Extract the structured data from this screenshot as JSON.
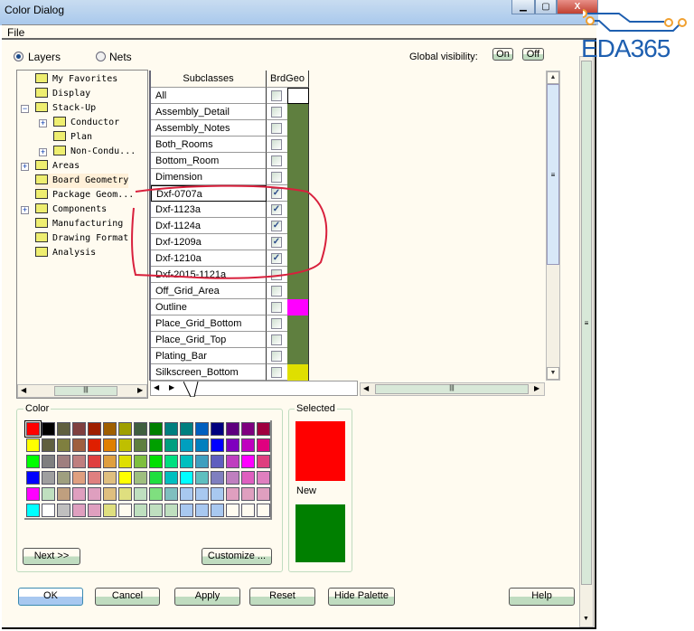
{
  "window": {
    "title": "Color Dialog",
    "controls": [
      "minimize",
      "maximize",
      "close"
    ]
  },
  "menu": {
    "file": "File"
  },
  "mode": {
    "layers": "Layers",
    "nets": "Nets",
    "selected": "Layers"
  },
  "global_visibility": {
    "label": "Global visibility:",
    "on": "On",
    "off": "Off"
  },
  "tree": [
    {
      "label": "My Favorites",
      "level": 0,
      "expander": ""
    },
    {
      "label": "Display",
      "level": 0,
      "expander": ""
    },
    {
      "label": "Stack-Up",
      "level": 0,
      "expander": "-"
    },
    {
      "label": "Conductor",
      "level": 1,
      "expander": "+"
    },
    {
      "label": "Plan",
      "level": 1,
      "expander": ""
    },
    {
      "label": "Non-Condu...",
      "level": 1,
      "expander": "+"
    },
    {
      "label": "Areas",
      "level": 0,
      "expander": "+"
    },
    {
      "label": "Board Geometry",
      "level": 0,
      "expander": "",
      "selected": true
    },
    {
      "label": "Package Geom...",
      "level": 0,
      "expander": ""
    },
    {
      "label": "Components",
      "level": 0,
      "expander": "+"
    },
    {
      "label": "Manufacturing",
      "level": 0,
      "expander": ""
    },
    {
      "label": "Drawing Format",
      "level": 0,
      "expander": ""
    },
    {
      "label": "Analysis",
      "level": 0,
      "expander": ""
    }
  ],
  "table": {
    "headers": {
      "subclasses": "Subclasses",
      "column": "BrdGeo"
    },
    "rows": [
      {
        "name": "All",
        "checked": false,
        "color": "#ffffff"
      },
      {
        "name": "Assembly_Detail",
        "checked": false,
        "color": "#5f7f3f"
      },
      {
        "name": "Assembly_Notes",
        "checked": false,
        "color": "#5f7f3f"
      },
      {
        "name": "Both_Rooms",
        "checked": false,
        "color": "#5f7f3f"
      },
      {
        "name": "Bottom_Room",
        "checked": false,
        "color": "#5f7f3f"
      },
      {
        "name": "Dimension",
        "checked": false,
        "color": "#5f7f3f"
      },
      {
        "name": "Dxf-0707a",
        "checked": true,
        "color": "#5f7f3f"
      },
      {
        "name": "Dxf-1123a",
        "checked": true,
        "color": "#5f7f3f"
      },
      {
        "name": "Dxf-1124a",
        "checked": true,
        "color": "#5f7f3f"
      },
      {
        "name": "Dxf-1209a",
        "checked": true,
        "color": "#5f7f3f"
      },
      {
        "name": "Dxf-1210a",
        "checked": true,
        "color": "#5f7f3f"
      },
      {
        "name": "Dxf-2015-1121a",
        "checked": false,
        "color": "#5f7f3f"
      },
      {
        "name": "Off_Grid_Area",
        "checked": false,
        "color": "#5f7f3f"
      },
      {
        "name": "Outline",
        "checked": false,
        "color": "#ff00ff"
      },
      {
        "name": "Place_Grid_Bottom",
        "checked": false,
        "color": "#5f7f3f"
      },
      {
        "name": "Place_Grid_Top",
        "checked": false,
        "color": "#5f7f3f"
      },
      {
        "name": "Plating_Bar",
        "checked": false,
        "color": "#5f7f3f"
      },
      {
        "name": "Silkscreen_Bottom",
        "checked": false,
        "color": "#dfdf00"
      }
    ]
  },
  "color_group": {
    "label": "Color",
    "next": "Next >>",
    "customize": "Customize ...",
    "palette": [
      [
        "#ff0000",
        "#000000",
        "#5f5f3f",
        "#7f3f3f",
        "#9f1f00",
        "#9f5f00",
        "#9f9f00",
        "#3f5f3f",
        "#007f00",
        "#007f7f",
        "#007f7f",
        "#005fbf",
        "#00007f",
        "#5f007f",
        "#7f007f",
        "#9f003f"
      ],
      [
        "#ffff00",
        "#5f5f3f",
        "#7f7f3f",
        "#9f5f3f",
        "#df1f00",
        "#df7f00",
        "#bfbf00",
        "#5f7f3f",
        "#009f00",
        "#009f7f",
        "#009fbf",
        "#007fbf",
        "#0000ff",
        "#7f00bf",
        "#bf00bf",
        "#df007f"
      ],
      [
        "#00ff00",
        "#7f7f7f",
        "#9f7f7f",
        "#bf7f7f",
        "#df3f3f",
        "#df9f3f",
        "#dfdf00",
        "#7fbf3f",
        "#00df00",
        "#00df7f",
        "#00bfbf",
        "#3f9fbf",
        "#5f5fbf",
        "#bf3fbf",
        "#ff00ff",
        "#df3f7f"
      ],
      [
        "#0000ff",
        "#9f9f9f",
        "#9f9f7f",
        "#df9f7f",
        "#df7f7f",
        "#dfbf7f",
        "#ffff00",
        "#9fbf7f",
        "#1fdf3f",
        "#00bfbf",
        "#00ffff",
        "#5fbfbf",
        "#7f7fbf",
        "#bf7fbf",
        "#df5fbf",
        "#df7fbf"
      ],
      [
        "#ff00ff",
        "#bfdfbf",
        "#bf9f7f",
        "#df9fbf",
        "#df9fbf",
        "#dfbf7f",
        "#dfdf7f",
        "#bfdfbf",
        "#7fdf7f",
        "#7fbfbf",
        "#a8c8f0",
        "#a8c8f0",
        "#a8c8f0",
        "#df9fbf",
        "#df9fbf",
        "#df9fbf"
      ],
      [
        "#00ffff",
        "#ffffff",
        "#bfbfbf",
        "#df9fbf",
        "#df9fbf",
        "#dfdf7f",
        "#fffbf0",
        "#bfdfbf",
        "#bfdfbf",
        "#bfdfbf",
        "#a8c8f0",
        "#a8c8f0",
        "#a8c8f0",
        "#fffbf0",
        "#fffbf0",
        "#fffbf0"
      ]
    ]
  },
  "selected_group": {
    "label": "Selected",
    "selected_color": "#ff0000",
    "new_label": "New",
    "new_color": "#007f00"
  },
  "buttons": {
    "ok": "OK",
    "cancel": "Cancel",
    "apply": "Apply",
    "reset": "Reset",
    "hide_palette": "Hide Palette",
    "help": "Help"
  },
  "watermark": {
    "text": "EDA365"
  },
  "colors": {
    "annotation": "#d8203c",
    "logo": "#1e5fb0",
    "logo_accent": "#f0a030"
  }
}
